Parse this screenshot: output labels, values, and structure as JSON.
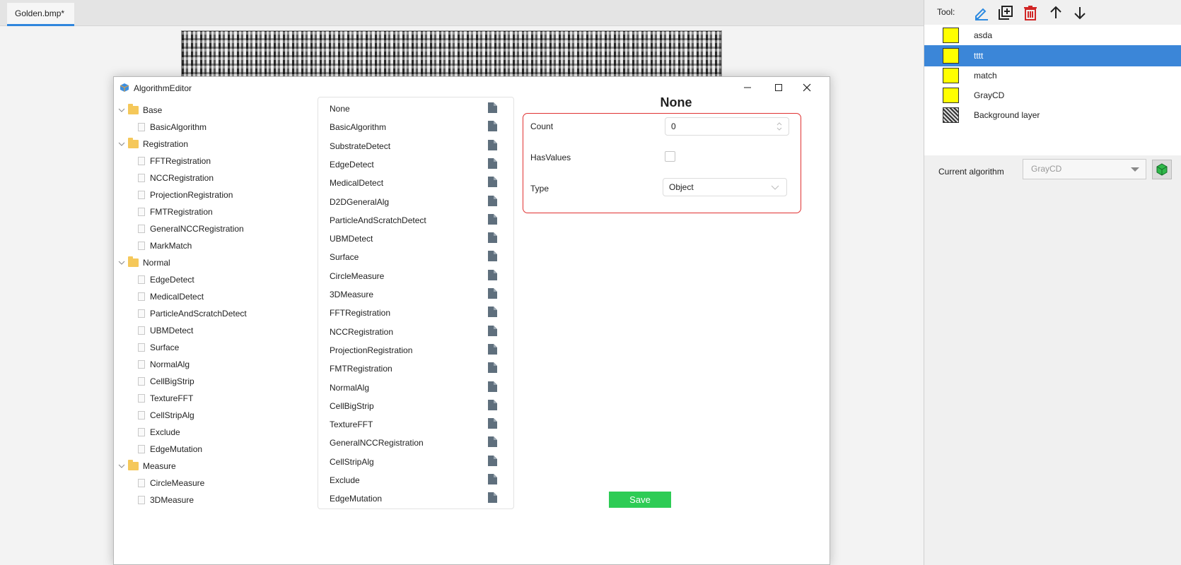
{
  "document": {
    "tab_title": "Golden.bmp*"
  },
  "right_panel": {
    "tool_label": "Tool:",
    "tools": [
      "edit-icon",
      "add-layer-icon",
      "delete-icon",
      "arrow-up-icon",
      "arrow-down-icon"
    ],
    "layers": [
      {
        "name": "asda",
        "swatch": "#ffff00",
        "selected": false
      },
      {
        "name": "tttt",
        "swatch": "#ffff00",
        "selected": true
      },
      {
        "name": "match",
        "swatch": "#ffff00",
        "selected": false
      },
      {
        "name": "GrayCD",
        "swatch": "#ffff00",
        "selected": false
      },
      {
        "name": "Background layer",
        "swatch": "image",
        "selected": false
      }
    ],
    "current_algorithm_label": "Current algorithm",
    "current_algorithm_value": "GrayCD"
  },
  "dialog": {
    "title": "AlgorithmEditor",
    "tree": [
      {
        "label": "Base",
        "type": "folder"
      },
      {
        "label": "BasicAlgorithm",
        "type": "item"
      },
      {
        "label": "Registration",
        "type": "folder"
      },
      {
        "label": "FFTRegistration",
        "type": "item"
      },
      {
        "label": "NCCRegistration",
        "type": "item"
      },
      {
        "label": "ProjectionRegistration",
        "type": "item"
      },
      {
        "label": "FMTRegistration",
        "type": "item"
      },
      {
        "label": "GeneralNCCRegistration",
        "type": "item"
      },
      {
        "label": "MarkMatch",
        "type": "item"
      },
      {
        "label": "Normal",
        "type": "folder"
      },
      {
        "label": "EdgeDetect",
        "type": "item"
      },
      {
        "label": "MedicalDetect",
        "type": "item"
      },
      {
        "label": "ParticleAndScratchDetect",
        "type": "item"
      },
      {
        "label": "UBMDetect",
        "type": "item"
      },
      {
        "label": "Surface",
        "type": "item"
      },
      {
        "label": "NormalAlg",
        "type": "item"
      },
      {
        "label": "CellBigStrip",
        "type": "item"
      },
      {
        "label": "TextureFFT",
        "type": "item"
      },
      {
        "label": "CellStripAlg",
        "type": "item"
      },
      {
        "label": "Exclude",
        "type": "item"
      },
      {
        "label": "EdgeMutation",
        "type": "item"
      },
      {
        "label": "Measure",
        "type": "folder"
      },
      {
        "label": "CircleMeasure",
        "type": "item"
      },
      {
        "label": "3DMeasure",
        "type": "item"
      }
    ],
    "algorithms": [
      "None",
      "BasicAlgorithm",
      "SubstrateDetect",
      "EdgeDetect",
      "MedicalDetect",
      "D2DGeneralAlg",
      "ParticleAndScratchDetect",
      "UBMDetect",
      "Surface",
      "CircleMeasure",
      "3DMeasure",
      "FFTRegistration",
      "NCCRegistration",
      "ProjectionRegistration",
      "FMTRegistration",
      "NormalAlg",
      "CellBigStrip",
      "TextureFFT",
      "GeneralNCCRegistration",
      "CellStripAlg",
      "Exclude",
      "EdgeMutation"
    ],
    "properties": {
      "title": "None",
      "count_label": "Count",
      "count_value": "0",
      "has_values_label": "HasValues",
      "has_values_checked": false,
      "type_label": "Type",
      "type_value": "Object"
    },
    "save_label": "Save",
    "accent_color": "#e03131",
    "save_color": "#2ecc55",
    "selection_color": "#3b86d8"
  }
}
